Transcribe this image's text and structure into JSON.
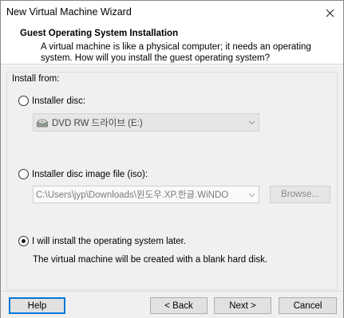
{
  "window": {
    "title": "New Virtual Machine Wizard"
  },
  "header": {
    "title": "Guest Operating System Installation",
    "description": "A virtual machine is like a physical computer; it needs an operating system. How will you install the guest operating system?"
  },
  "install_from": {
    "label": "Install from:",
    "installer_disc": {
      "label": "Installer disc:",
      "selected": false,
      "drive_value": "DVD RW 드라이브 (E:)"
    },
    "iso": {
      "label": "Installer disc image file (iso):",
      "selected": false,
      "path_value": "C:\\Users\\jyp\\Downloads\\윈도우.XP.한글.WiNDO",
      "browse_label": "Browse..."
    },
    "later": {
      "label": "I will install the operating system later.",
      "selected": true,
      "description": "The virtual machine will be created with a blank hard disk."
    }
  },
  "footer": {
    "help_label": "Help",
    "back_label": "< Back",
    "next_label": "Next >",
    "cancel_label": "Cancel"
  }
}
